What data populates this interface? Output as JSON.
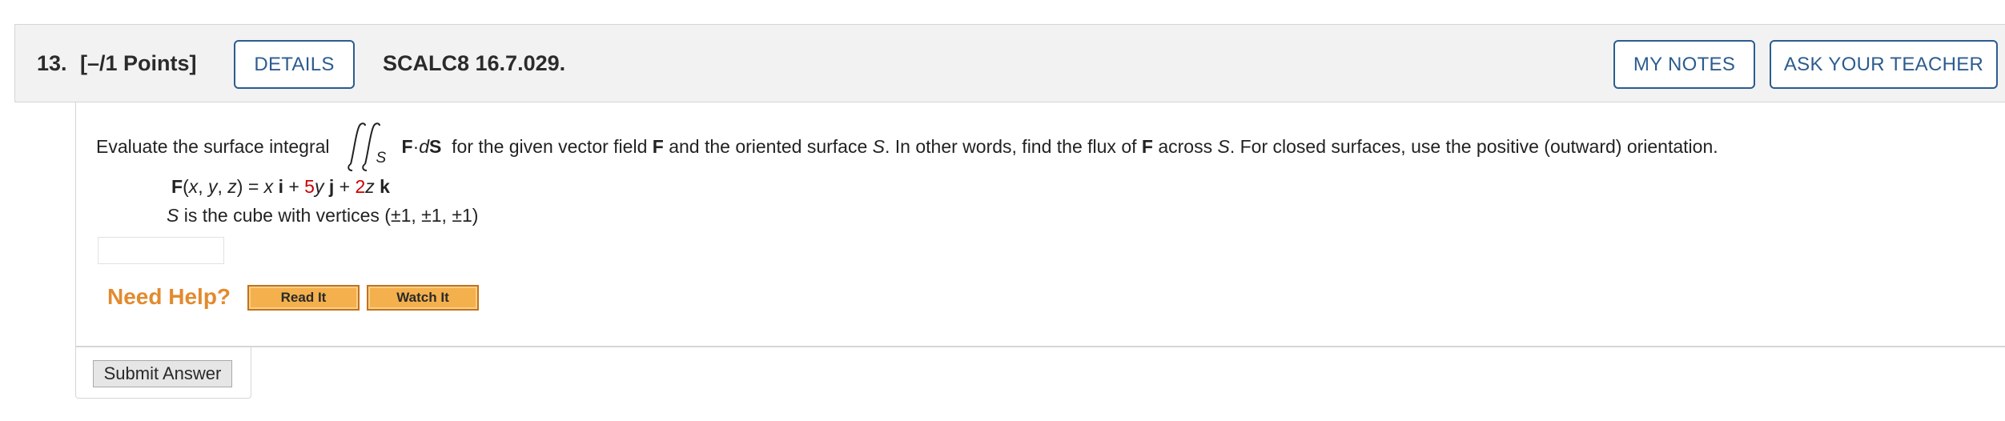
{
  "header": {
    "question_number": "13.",
    "points": "[–/1 Points]",
    "details_label": "DETAILS",
    "problem_code": "SCALC8 16.7.029.",
    "my_notes_label": "MY NOTES",
    "ask_teacher_label": "ASK YOUR TEACHER"
  },
  "question": {
    "prompt_before": "Evaluate the surface integral",
    "integral_subscript": "S",
    "integrand_F": "F",
    "integrand_dot": " · ",
    "integrand_d": "d",
    "integrand_S": "S",
    "prompt_mid1": "for the given vector field",
    "prompt_F": "F",
    "prompt_mid2": "and the oriented surface",
    "prompt_S": "S",
    "prompt_mid3": ". In other words, find the flux of",
    "prompt_F2": "F",
    "prompt_mid4": "across",
    "prompt_S2": "S",
    "prompt_end": ". For closed surfaces, use the positive (outward) orientation.",
    "field": {
      "F": "F",
      "args_open": "(",
      "x": "x",
      "comma1": ", ",
      "y": "y",
      "comma2": ", ",
      "z": "z",
      "args_close": ") = ",
      "term1_var": "x",
      "i": "i",
      "plus1": " + ",
      "coef2": "5",
      "term2_var": "y",
      "j": "j",
      "plus2": " + ",
      "coef3": "2",
      "term3_var": "z",
      "k": "k"
    },
    "surface": {
      "S": "S",
      "text": " is the cube with vertices  (±1, ±1, ±1)"
    },
    "answer_value": ""
  },
  "help": {
    "need_help_label": "Need Help?",
    "read_it_label": "Read It",
    "watch_it_label": "Watch It"
  },
  "submit": {
    "label": "Submit Answer"
  },
  "colors": {
    "accent": "#2c5c8f",
    "need_help": "#e38a2e",
    "highlight": "#cc0000",
    "help_button": "#f4b04d"
  }
}
